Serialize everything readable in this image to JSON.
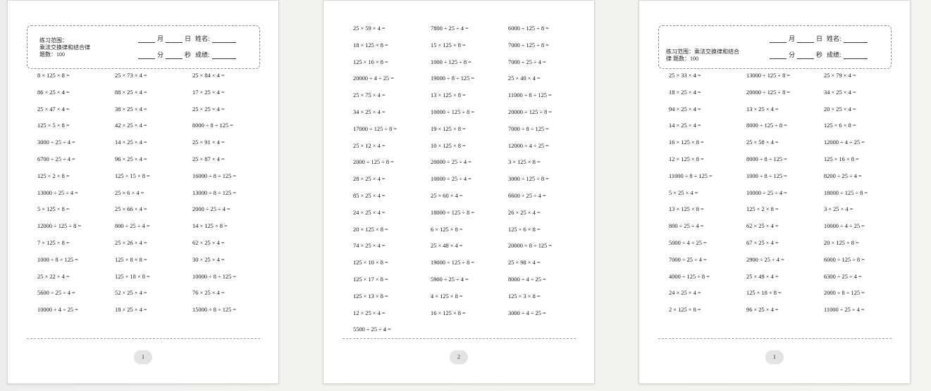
{
  "pages": [
    {
      "header": {
        "range_label": "练习范围：",
        "range_value": "乘法交换律和结合律",
        "count": "题数：100",
        "month": "月",
        "day": "日",
        "name": "姓名:",
        "minute": "分",
        "second": "秒",
        "score": "成绩:"
      },
      "problems": [
        "8 × 125 × 8 =",
        "25 × 73 × 4 =",
        "25 × 84 × 4 =",
        "86 × 25 × 4 =",
        "88 × 25 × 4 =",
        "17 × 25 × 4 =",
        "25 × 47 × 4 =",
        "38 × 25 × 4 =",
        "25 × 25 × 4 =",
        "125 × 5 × 8 =",
        "42 × 25 × 4 =",
        "8000 ÷ 8 ÷ 125 =",
        "3000 ÷ 25 ÷ 4 =",
        "14 × 25 × 4 =",
        "25 × 91 × 4 =",
        "6700 ÷ 25 ÷ 4 =",
        "96 × 25 × 4 =",
        "25 × 87 × 4 =",
        "125 × 2 × 8 =",
        "125 × 15 × 8 =",
        "16000 ÷ 8 ÷ 125 =",
        "13000 ÷ 25 ÷ 4 =",
        "25 × 6 × 4 =",
        "13000 ÷ 8 ÷ 125 =",
        "5 × 125 × 8 =",
        "25 × 66 × 4 =",
        "2000 ÷ 25 ÷ 4 =",
        "12000 ÷ 125 ÷ 8 =",
        "800 ÷ 25 ÷ 4 =",
        "14 × 125 × 8 =",
        "7 × 125 × 8 =",
        "25 × 26 × 4 =",
        "62 × 25 × 4 =",
        "1000 ÷ 8 ÷ 125 =",
        "125 × 8 × 8 =",
        "30 × 25 × 4 =",
        "25 × 22 × 4 =",
        "125 × 18 × 8 =",
        "10000 ÷ 8 ÷ 125 =",
        "5600 ÷ 25 ÷ 4 =",
        "52 × 25 × 4 =",
        "76 × 25 × 4 =",
        "10000 ÷ 4 ÷ 25 =",
        "18 × 25 × 4 =",
        "15000 ÷ 8 ÷ 125 ="
      ],
      "page_number": "1"
    },
    {
      "problems": [
        "25 × 59 × 4 =",
        "7800 ÷ 25 ÷ 4 =",
        "6000 ÷ 125 ÷ 8 =",
        "18 × 125 × 8 =",
        "15 × 125 × 8 =",
        "7000 ÷ 125 ÷ 8 =",
        "125 × 16 × 8 =",
        "1000 ÷ 125 ÷ 8 =",
        "7000 ÷ 25 ÷ 4 =",
        "20000 ÷ 4 ÷ 25 =",
        "19000 ÷ 8 ÷ 125 =",
        "25 × 40 × 4 =",
        "25 × 75 × 4 =",
        "13 × 125 × 8 =",
        "11000 ÷ 8 ÷ 125 =",
        "34 × 25 × 4 =",
        "10000 ÷ 125 ÷ 8 =",
        "20000 ÷ 125 ÷ 8 =",
        "17000 ÷ 125 ÷ 8 =",
        "19 × 125 × 8 =",
        "7000 ÷ 8 ÷ 125 =",
        "25 × 12 × 4 =",
        "10 × 125 × 8 =",
        "12000 ÷ 4 ÷ 25 =",
        "2000 ÷ 125 ÷ 8 =",
        "20000 ÷ 25 ÷ 4 =",
        "3 × 125 × 8 =",
        "28 × 25 × 4 =",
        "10000 ÷ 25 ÷ 4 =",
        "3000 ÷ 125 ÷ 8 =",
        "85 × 25 × 4 =",
        "25 × 60 × 4 =",
        "6600 ÷ 25 ÷ 4 =",
        "24 × 25 × 4 =",
        "18000 ÷ 125 ÷ 8 =",
        "26 × 25 × 4 =",
        "20 × 125 × 8 =",
        "6 × 125 × 8 =",
        "125 × 6 × 8 =",
        "74 × 25 × 4 =",
        "25 × 48 × 4 =",
        "20000 ÷ 8 ÷ 125 =",
        "125 × 10 × 8 =",
        "19000 ÷ 125 ÷ 8 =",
        "25 × 98 × 4 =",
        "125 × 17 × 8 =",
        "5900 ÷ 25 ÷ 4 =",
        "8000 ÷ 4 ÷ 25 =",
        "125 × 13 × 8 =",
        "4 × 125 × 8 =",
        "125 × 3 × 8 =",
        "12 × 25 × 4 =",
        "16 × 125 × 8 =",
        "3000 ÷ 4 ÷ 25 =",
        "5500 ÷ 25 ÷ 4 ="
      ],
      "page_number": "2"
    },
    {
      "header": {
        "range_label": "练习范围：乘法交换律和结合",
        "range_value": "律  题数：100",
        "month": "月",
        "day": "日",
        "name": "姓名:",
        "minute": "分",
        "second": "秒",
        "score": "成绩:"
      },
      "problems": [
        "25 × 33 × 4 =",
        "13000 ÷ 125 ÷ 8 =",
        "25 × 79 × 4 =",
        "18 × 25 × 4 =",
        "20000 ÷ 125 ÷ 8 =",
        "34 × 25 × 4 =",
        "94 × 25 × 4 =",
        "13 × 25 × 4 =",
        "20 × 25 × 4 =",
        "14 × 25 × 4 =",
        "8000 ÷ 125 ÷ 8 =",
        "125 × 6 × 8 =",
        "16 × 125 × 8 =",
        "25 × 58 × 4 =",
        "12000 ÷ 4 ÷ 25 =",
        "12 × 125 × 8 =",
        "8000 ÷ 8 ÷ 125 =",
        "125 × 16 × 8 =",
        "11000 ÷ 8 ÷ 125 =",
        "1000 ÷ 8 ÷ 125 =",
        "8200 ÷ 25 ÷ 4 =",
        "5 × 25 × 4 =",
        "10000 ÷ 25 ÷ 4 =",
        "18000 ÷ 125 ÷ 8 =",
        "13 × 125 × 8 =",
        "125 × 2 × 8 =",
        "3 × 25 × 4 =",
        "800 ÷ 25 ÷ 4 =",
        "62 × 25 × 4 =",
        "10000 ÷ 4 ÷ 25 =",
        "5000 ÷ 4 ÷ 25 =",
        "67 × 25 × 4 =",
        "20 × 125 × 8 =",
        "7000 ÷ 25 ÷ 4 =",
        "2900 ÷ 25 ÷ 4 =",
        "6000 ÷ 125 ÷ 8 =",
        "4000 ÷ 125 ÷ 8 =",
        "25 × 49 × 4 =",
        "6300 ÷ 25 ÷ 4 =",
        "24 × 25 × 4 =",
        "125 × 18 × 8 =",
        "2000 ÷ 8 ÷ 125 =",
        "2 × 125 × 8 =",
        "96 × 25 × 4 =",
        "11000 ÷ 25 ÷ 4 ="
      ],
      "page_number": "1"
    }
  ]
}
